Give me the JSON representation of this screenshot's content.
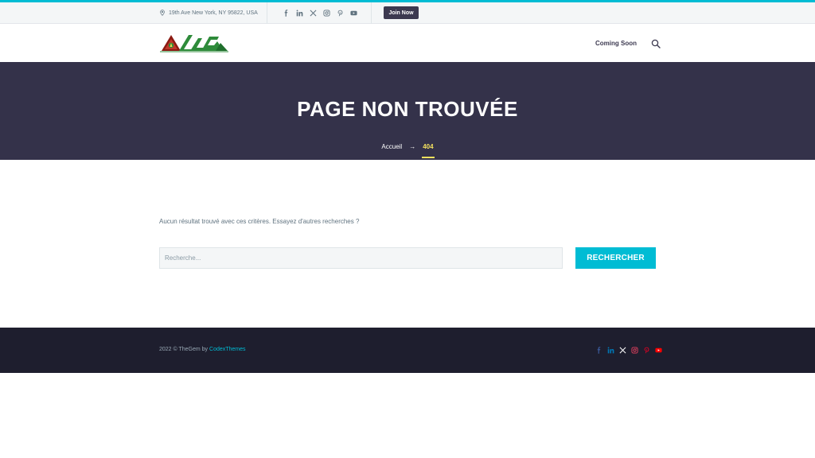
{
  "colors": {
    "accent": "#00bcd4",
    "banner_bg": "#34324a",
    "footer_bg": "#1e1e2e",
    "breadcrumb_current": "#f5e25f",
    "facebook": "#3b5998",
    "linkedin": "#0077b5",
    "x": "#ffffff",
    "instagram": "#e4405f",
    "pinterest": "#e60023",
    "youtube": "#ff0000"
  },
  "topbar": {
    "address": "19th Ave New York, NY 95822, USA",
    "address_icon": "map-pin-icon",
    "socials": [
      "facebook-icon",
      "linkedin-icon",
      "x-icon",
      "instagram-icon",
      "pinterest-icon",
      "youtube-icon"
    ],
    "join_label": "Join Now"
  },
  "header": {
    "logo_icon": "site-logo",
    "nav": [
      "Coming Soon"
    ],
    "search_icon": "search-icon"
  },
  "banner": {
    "title": "PAGE NON TROUVÉE",
    "breadcrumb": {
      "home": "Accueil",
      "separator": "→",
      "current": "404"
    }
  },
  "content": {
    "message": "Aucun résultat trouvé avec ces critères. Essayez d'autres recherches ?",
    "search_placeholder": "Recherche...",
    "search_button": "RECHERCHER"
  },
  "footer": {
    "copyright_prefix": "2022 © TheGem by ",
    "copyright_link": "CodexThemes",
    "socials": [
      "facebook-icon",
      "linkedin-icon",
      "x-icon",
      "instagram-icon",
      "pinterest-icon",
      "youtube-icon"
    ]
  }
}
